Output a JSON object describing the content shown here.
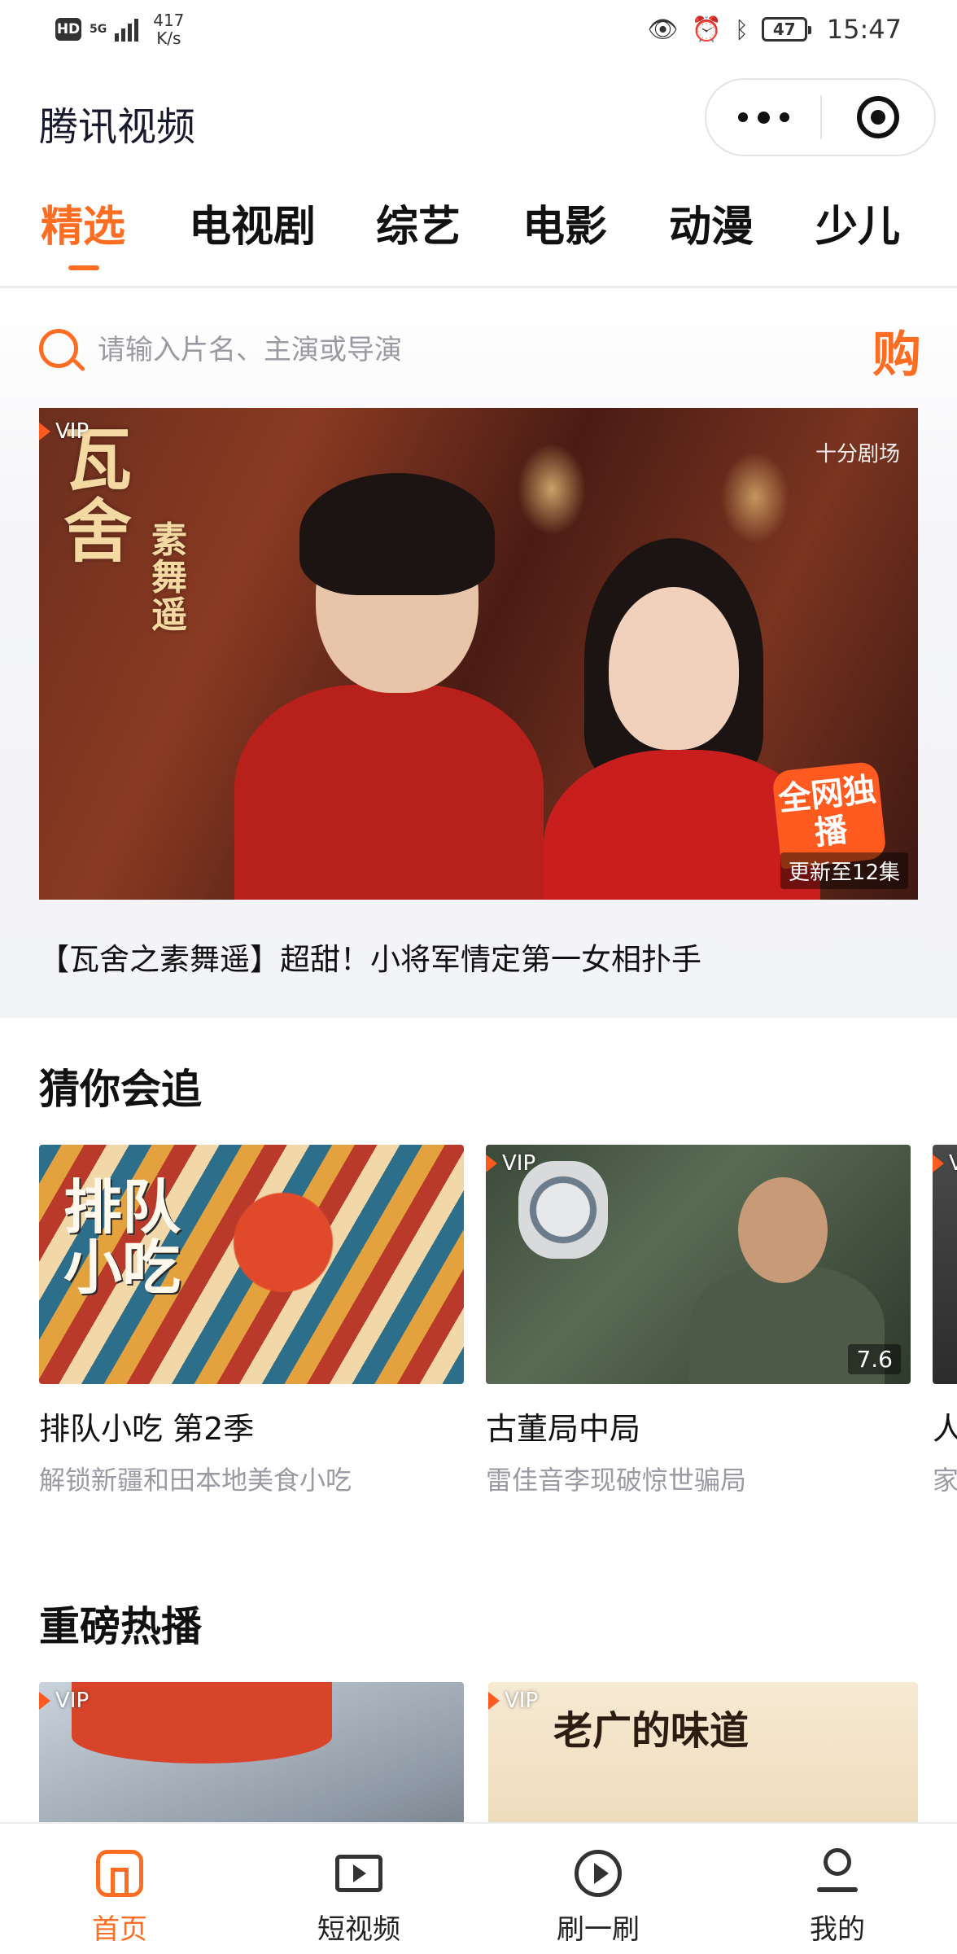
{
  "status_bar": {
    "hd": "HD",
    "network": "5G",
    "speed_value": "417",
    "speed_unit": "K/s",
    "battery": "47",
    "time": "15:47"
  },
  "header": {
    "title": "腾讯视频"
  },
  "tabs": [
    {
      "label": "精选",
      "active": true
    },
    {
      "label": "电视剧",
      "active": false
    },
    {
      "label": "综艺",
      "active": false
    },
    {
      "label": "电影",
      "active": false
    },
    {
      "label": "动漫",
      "active": false
    },
    {
      "label": "少儿",
      "active": false
    }
  ],
  "search": {
    "placeholder": "请输入片名、主演或导演",
    "buy_label": "购"
  },
  "banner": {
    "vip": "VIP",
    "brand": "十分剧场",
    "title_art": "瓦舍之素舞遥",
    "exclusive": "全网独播",
    "update": "更新至12集",
    "caption": "【瓦舍之素舞遥】超甜！小将军情定第一女相扑手"
  },
  "sections": {
    "guess": {
      "title": "猜你会追",
      "cards": [
        {
          "title": "排队小吃 第2季",
          "subtitle": "解锁新疆和田本地美食小吃",
          "vip": "",
          "score": "",
          "art": "排队小吃"
        },
        {
          "title": "古董局中局",
          "subtitle": "雷佳音李现破惊世骗局",
          "vip": "VIP",
          "score": "7.6"
        },
        {
          "title": "人",
          "subtitle": "家",
          "vip": "V"
        }
      ]
    },
    "hot": {
      "title": "重磅热播",
      "cards": [
        {
          "vip": "VIP"
        },
        {
          "vip": "VIP",
          "art": "老广的味道"
        }
      ]
    }
  },
  "bottom_nav": [
    {
      "label": "首页",
      "icon": "home-icon",
      "active": true
    },
    {
      "label": "短视频",
      "icon": "video-icon",
      "active": false
    },
    {
      "label": "刷一刷",
      "icon": "swipe-icon",
      "active": false
    },
    {
      "label": "我的",
      "icon": "profile-icon",
      "active": false
    }
  ],
  "colors": {
    "accent": "#ff6d22",
    "text": "#111111",
    "muted": "#9a9aa3"
  }
}
